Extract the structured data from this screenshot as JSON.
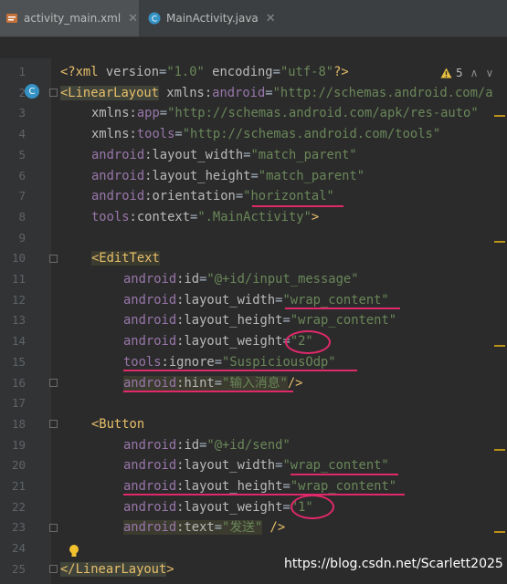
{
  "tabs": [
    {
      "label": "activity_main.xml",
      "icon": "xml-file-icon"
    },
    {
      "label": "MainActivity.java",
      "icon": "java-class-icon"
    }
  ],
  "inspection": {
    "warning_count": "5"
  },
  "line_numbers": [
    "1",
    "2",
    "3",
    "4",
    "5",
    "6",
    "7",
    "8",
    "9",
    "10",
    "11",
    "12",
    "13",
    "14",
    "15",
    "16",
    "17",
    "18",
    "19",
    "20",
    "21",
    "22",
    "23",
    "24",
    "25"
  ],
  "code": {
    "l1": {
      "p1": "<?",
      "p2": "xml",
      "p3": " version",
      "p4": "=",
      "p5": "\"1.0\"",
      "p6": " encoding",
      "p7": "=",
      "p8": "\"utf-8\"",
      "p9": "?>"
    },
    "l2": {
      "p1": "<LinearLayout",
      "p2": " xmlns:",
      "p3": "android",
      "p4": "=",
      "p5": "\"http://schemas.android.com/a"
    },
    "l3": {
      "p1": "xmlns:",
      "p2": "app",
      "p3": "=",
      "p4": "\"http://schemas.android.com/apk/res-auto\""
    },
    "l4": {
      "p1": "xmlns:",
      "p2": "tools",
      "p3": "=",
      "p4": "\"http://schemas.android.com/tools\""
    },
    "l5": {
      "p1": "android",
      "p2": ":layout_width",
      "p3": "=",
      "p4": "\"match_parent\""
    },
    "l6": {
      "p1": "android",
      "p2": ":layout_height",
      "p3": "=",
      "p4": "\"match_parent\""
    },
    "l7": {
      "p1": "android",
      "p2": ":orientation",
      "p3": "=",
      "p4": "\"horizontal\""
    },
    "l8": {
      "p1": "tools",
      "p2": ":context",
      "p3": "=",
      "p4": "\".MainActivity\"",
      "p5": ">"
    },
    "l10": {
      "p1": "<EditText"
    },
    "l11": {
      "p1": "android",
      "p2": ":id",
      "p3": "=",
      "p4": "\"@+id/input_message\""
    },
    "l12": {
      "p1": "android",
      "p2": ":layout_width",
      "p3": "=",
      "p4": "\"wrap_content\""
    },
    "l13": {
      "p1": "android",
      "p2": ":layout_height",
      "p3": "=",
      "p4": "\"wrap_content\""
    },
    "l14": {
      "p1": "android",
      "p2": ":layout_weight",
      "p3": "=",
      "p4": "\"2\""
    },
    "l15": {
      "p1": "tools",
      "p2": ":ignore",
      "p3": "=",
      "p4": "\"SuspiciousOdp\""
    },
    "l16": {
      "p1": "android",
      "p2": ":hint",
      "p3": "=",
      "p4": "\"输入消息\"",
      "p5": "/>"
    },
    "l18": {
      "p1": "<Button"
    },
    "l19": {
      "p1": "android",
      "p2": ":id",
      "p3": "=",
      "p4": "\"@+id/send\""
    },
    "l20": {
      "p1": "android",
      "p2": ":layout_width",
      "p3": "=",
      "p4": "\"wrap_content\""
    },
    "l21": {
      "p1": "android",
      "p2": ":layout_height",
      "p3": "=",
      "p4": "\"wrap_content\""
    },
    "l22": {
      "p1": "android",
      "p2": ":layout_weight",
      "p3": "=",
      "p4": "\"1\""
    },
    "l23": {
      "p1": "android",
      "p2": ":text",
      "p3": "=",
      "p4": "\"发送\"",
      "p5": " />"
    },
    "l25": {
      "p1": "</LinearLayout",
      "p2": ">"
    }
  },
  "watermark": "https://blog.csdn.net/Scarlett2025",
  "colors": {
    "annotation": "#e0286a",
    "background": "#2b2b2b",
    "tag": "#e8bf6a",
    "string": "#6a8759",
    "namespace": "#9876aa"
  }
}
